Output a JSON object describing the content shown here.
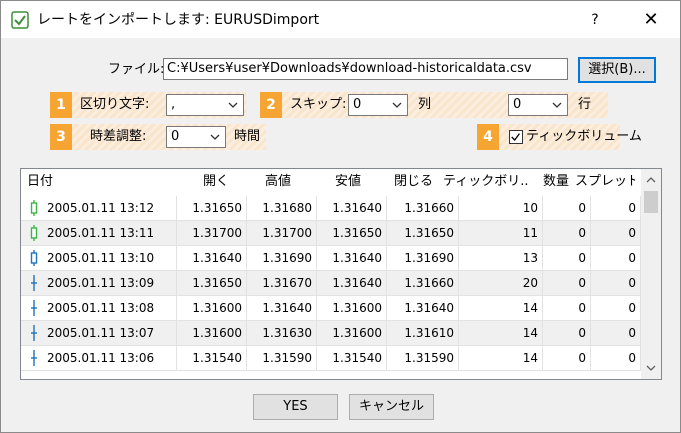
{
  "window": {
    "title": "レートをインポートします: EURUSDimport",
    "help": "?",
    "close": "✕"
  },
  "file": {
    "label": "ファイル:",
    "value": "C:¥Users¥user¥Downloads¥download-historicaldata.csv",
    "browse_label": "選択(B)..."
  },
  "options": {
    "badge1": "1",
    "delimiter_label": "区切り文字:",
    "delimiter_value": ",",
    "badge2": "2",
    "skip_label": "スキップ:",
    "skip_value1": "0",
    "col_label": "列",
    "skip_value2": "0",
    "row_label": "行",
    "badge3": "3",
    "timeshift_label": "時差調整:",
    "timeshift_value": "0",
    "time_unit": "時間",
    "badge4": "4",
    "tick_volume_label": "ティックボリューム",
    "tick_volume_checked": true
  },
  "table": {
    "headers": [
      "日付",
      "開く",
      "高値",
      "安値",
      "閉じる",
      "ティックボリ...",
      "数量",
      "スプレッド"
    ],
    "rows": [
      {
        "date": "2005.01.11 13:12",
        "open": "1.31650",
        "high": "1.31680",
        "low": "1.31640",
        "close": "1.31660",
        "tick": "10",
        "vol": "0",
        "spread": "0",
        "candle": "bull"
      },
      {
        "date": "2005.01.11 13:11",
        "open": "1.31700",
        "high": "1.31700",
        "low": "1.31650",
        "close": "1.31650",
        "tick": "11",
        "vol": "0",
        "spread": "0",
        "candle": "bull"
      },
      {
        "date": "2005.01.11 13:10",
        "open": "1.31640",
        "high": "1.31690",
        "low": "1.31640",
        "close": "1.31690",
        "tick": "13",
        "vol": "0",
        "spread": "0",
        "candle": "bear"
      },
      {
        "date": "2005.01.11 13:09",
        "open": "1.31650",
        "high": "1.31670",
        "low": "1.31640",
        "close": "1.31660",
        "tick": "20",
        "vol": "0",
        "spread": "0",
        "candle": "doji"
      },
      {
        "date": "2005.01.11 13:08",
        "open": "1.31600",
        "high": "1.31640",
        "low": "1.31600",
        "close": "1.31640",
        "tick": "14",
        "vol": "0",
        "spread": "0",
        "candle": "doji"
      },
      {
        "date": "2005.01.11 13:07",
        "open": "1.31600",
        "high": "1.31630",
        "low": "1.31600",
        "close": "1.31610",
        "tick": "14",
        "vol": "0",
        "spread": "0",
        "candle": "doji"
      },
      {
        "date": "2005.01.11 13:06",
        "open": "1.31540",
        "high": "1.31590",
        "low": "1.31540",
        "close": "1.31590",
        "tick": "14",
        "vol": "0",
        "spread": "0",
        "candle": "doji"
      }
    ]
  },
  "buttons": {
    "yes": "YES",
    "cancel": "キャンセル"
  },
  "colors": {
    "accent": "#0078d7",
    "badge": "#f6a532",
    "bull": "#3cb44b",
    "bear": "#1e73be"
  }
}
